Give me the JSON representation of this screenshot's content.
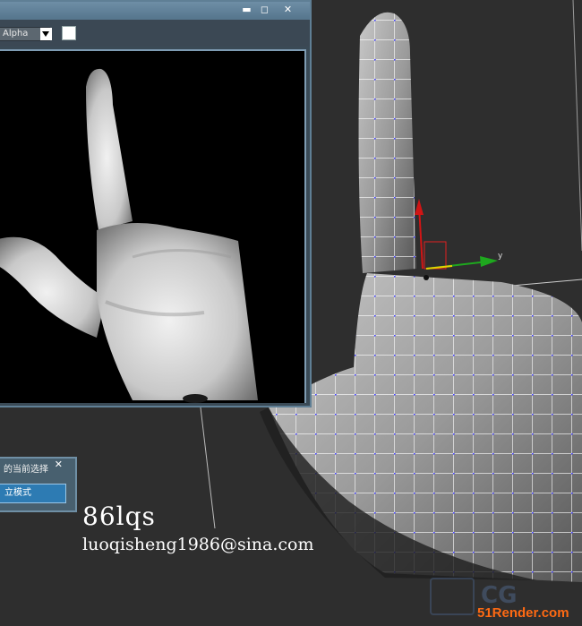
{
  "render_window": {
    "channel_value": "Alpha",
    "buttons": {
      "minimize": "▬",
      "maximize": "◻",
      "close": "✕"
    }
  },
  "float_panel": {
    "title": "的当前选择",
    "close": "✕",
    "mode_label": "立模式"
  },
  "caption": {
    "name": "86lqs",
    "email": "luoqisheng1986@sina.com"
  },
  "watermark": {
    "logo_text": "CG",
    "site": "51Render.com"
  },
  "gizmo": {
    "axis_label": "y"
  },
  "colors": {
    "window_frame": "#5f7f95",
    "panel_active": "#2d7bb3",
    "wireframe": "#ffffff",
    "vertex": "#4a48ff",
    "site_orange": "#ff6a13"
  }
}
